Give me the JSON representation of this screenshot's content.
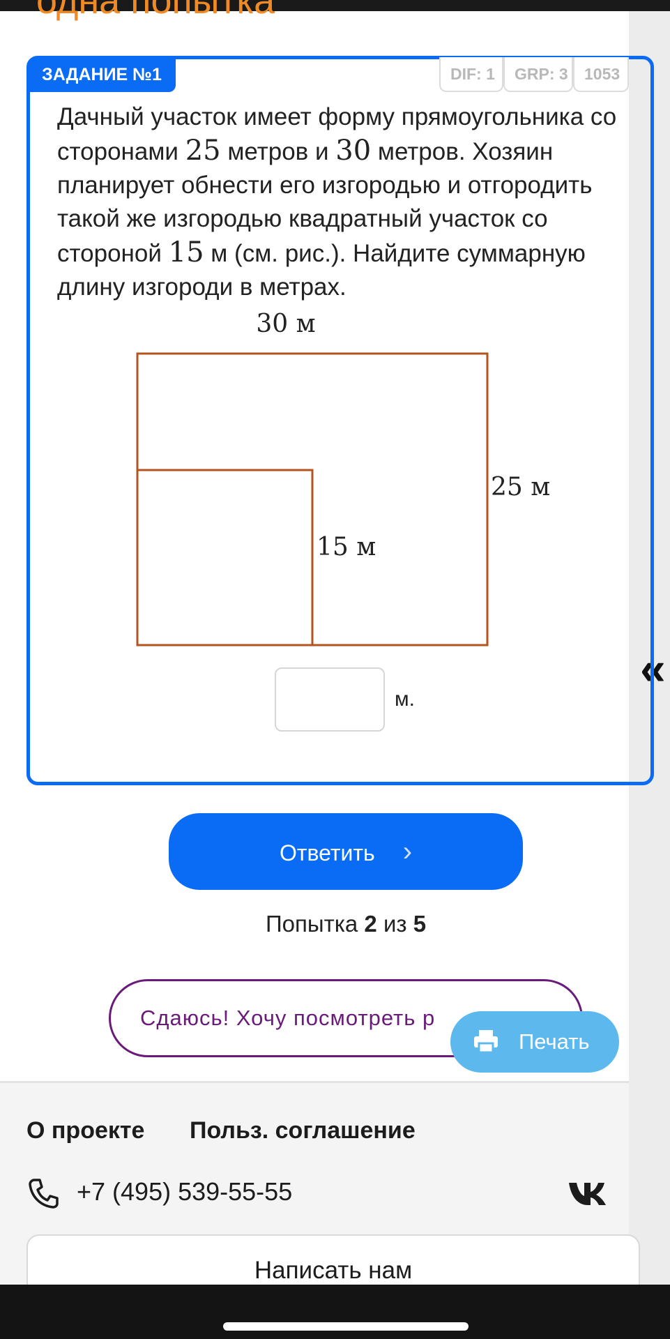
{
  "header": {
    "heading_fragment": "одна попытка"
  },
  "task": {
    "badge": "ЗАДАНИЕ №1",
    "meta": [
      "DIF: 1",
      "GRP: 3",
      "1053"
    ],
    "text": {
      "p1": "Дачный участок имеет форму прямоугольника со сторонами",
      "n1": "25",
      "p2": "метров и",
      "n2": "30",
      "p3": "метров. Хозяин планирует обнести его изгородью и отгородить такой же изгородью квадратный участок со стороной",
      "n3": "15",
      "p4": "м (см. рис.). Найдите суммарную длину изгороди в метрах."
    },
    "figure": {
      "top_label": "30 м",
      "right_label": "25 м",
      "inner_label": "15 м",
      "stroke_color": "#b5531f"
    },
    "answer": {
      "value": "",
      "unit": "м."
    }
  },
  "actions": {
    "submit_label": "Ответить",
    "submit_arrow": "›",
    "attempt_prefix": "Попытка",
    "attempt_current": "2",
    "attempt_sep": "из",
    "attempt_total": "5",
    "giveup_label": "Сдаюсь! Хочу посмотреть р",
    "print_label": "Печать"
  },
  "footer": {
    "about": "О проекте",
    "terms": "Польз. соглашение",
    "phone": "+7 (495) 539-55-55",
    "write_us": "Написать нам"
  },
  "sidebar": {
    "collapse_glyph": "«"
  },
  "colors": {
    "accent": "#0a6cf5",
    "heading_orange": "#f08a24",
    "giveup_purple": "#6a1b7a",
    "print_blue": "#5db8ee"
  }
}
